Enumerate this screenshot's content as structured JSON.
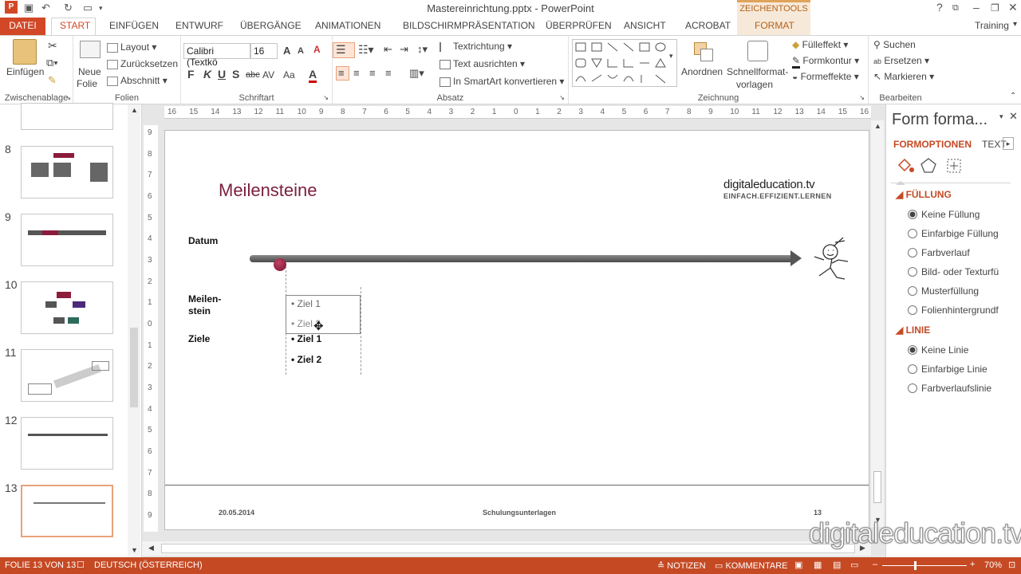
{
  "app": {
    "title": "Mastereinrichtung.pptx - PowerPoint",
    "context_group": "ZEICHENTOOLS",
    "user": "Training"
  },
  "tabs": [
    "DATEI",
    "START",
    "EINFÜGEN",
    "ENTWURF",
    "ÜBERGÄNGE",
    "ANIMATIONEN",
    "BILDSCHIRMPRÄSENTATION",
    "ÜBERPRÜFEN",
    "ANSICHT",
    "ACROBAT",
    "FORMAT"
  ],
  "active_tab": "START",
  "ribbon": {
    "clipboard": {
      "paste": "Einfügen",
      "label": "Zwischenablage"
    },
    "slides": {
      "new_slide": "Neue",
      "new_slide2": "Folie",
      "layout": "Layout",
      "reset": "Zurücksetzen",
      "section": "Abschnitt",
      "label": "Folien"
    },
    "font": {
      "name": "Calibri (Textkö",
      "size": "16",
      "bold": "F",
      "italic": "K",
      "underline": "U",
      "shadow": "S",
      "strike": "abc",
      "spacing": "AV",
      "case": "Aa",
      "color": "A",
      "grow": "A",
      "shrink": "A",
      "label": "Schriftart"
    },
    "paragraph": {
      "direction": "Textrichtung",
      "align": "Text ausrichten",
      "smartart": "In SmartArt konvertieren",
      "label": "Absatz"
    },
    "drawing": {
      "arrange": "Anordnen",
      "quick_styles": "Schnellformat-",
      "quick_styles2": "vorlagen",
      "fill": "Fülleffekt",
      "outline": "Formkontur",
      "effects": "Formeffekte",
      "label": "Zeichnung"
    },
    "editing": {
      "find": "Suchen",
      "replace": "Ersetzen",
      "select": "Markieren",
      "label": "Bearbeiten"
    }
  },
  "thumbnails": [
    {
      "num": "8"
    },
    {
      "num": "9"
    },
    {
      "num": "10"
    },
    {
      "num": "11"
    },
    {
      "num": "12"
    },
    {
      "num": "13"
    }
  ],
  "slide": {
    "title": "Meilensteine",
    "logo_brand": "digitaleducation.tv",
    "logo_tagline": "EINFACH.EFFIZIENT.LERNEN",
    "label_date": "Datum",
    "label_milestone1": "Meilen-",
    "label_milestone2": "stein",
    "label_goals": "Ziele",
    "box_items": [
      "Ziel 1",
      "Ziel 2"
    ],
    "goal_items": [
      "Ziel 1",
      "Ziel 2"
    ],
    "footer_date": "20.05.2014",
    "footer_center": "Schulungsunterlagen",
    "footer_page": "13"
  },
  "ruler": {
    "h_ticks": [
      "16",
      "15",
      "14",
      "13",
      "12",
      "11",
      "10",
      "9",
      "8",
      "7",
      "6",
      "5",
      "4",
      "3",
      "2",
      "1",
      "0",
      "1",
      "2",
      "3",
      "4",
      "5",
      "6",
      "7",
      "8",
      "9",
      "10",
      "11",
      "12",
      "13",
      "14",
      "15",
      "16"
    ],
    "v_ticks": [
      "9",
      "8",
      "7",
      "6",
      "5",
      "4",
      "3",
      "2",
      "1",
      "0",
      "1",
      "2",
      "3",
      "4",
      "5",
      "6",
      "7",
      "8",
      "9"
    ]
  },
  "taskpane": {
    "title": "Form forma...",
    "tab_options": "FORMOPTIONEN",
    "tab_text": "TEXT",
    "fill_header": "FÜLLUNG",
    "fill_options": [
      "Keine Füllung",
      "Einfarbige Füllung",
      "Farbverlauf",
      "Bild- oder Texturfü",
      "Musterfüllung",
      "Folienhintergrundf"
    ],
    "line_header": "LINIE",
    "line_options": [
      "Keine Linie",
      "Einfarbige Linie",
      "Farbverlaufslinie"
    ]
  },
  "status": {
    "slide_info": "FOLIE 13 VON 13",
    "language": "DEUTSCH (ÖSTERREICH)",
    "notes": "NOTIZEN",
    "comments": "KOMMENTARE",
    "zoom": "70%"
  },
  "watermark": "digitaleducation.tv",
  "colors": {
    "accent": "#d24726",
    "status": "#c54a24",
    "title": "#7a1f3d"
  }
}
